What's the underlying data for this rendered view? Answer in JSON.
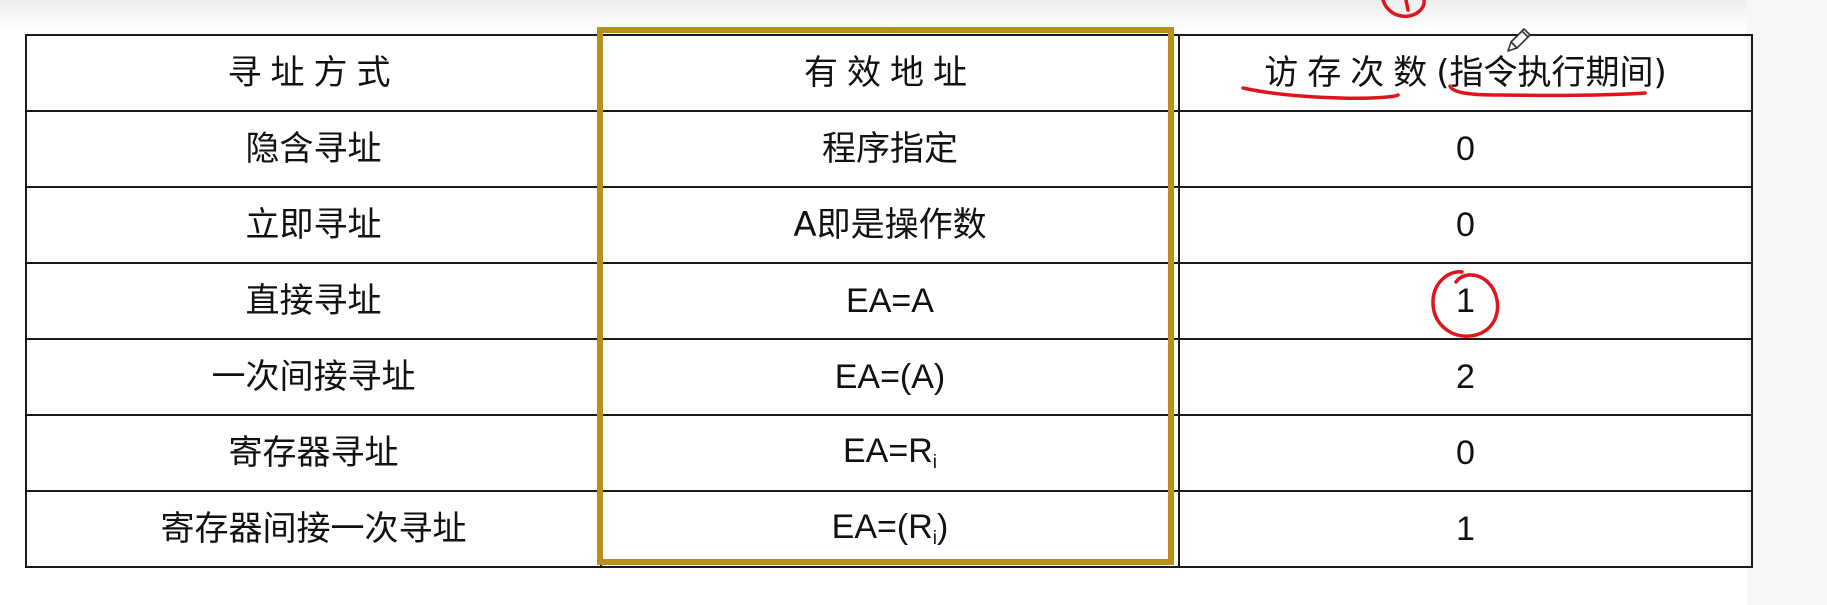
{
  "table": {
    "headers": {
      "mode": "寻址方式",
      "ea": "有效地址",
      "access_main": "访存次数",
      "access_note": "(指令执行期间)"
    },
    "rows": [
      {
        "mode": "隐含寻址",
        "ea": "程序指定",
        "count": "0"
      },
      {
        "mode": "立即寻址",
        "ea": "A即是操作数",
        "count": "0"
      },
      {
        "mode": "直接寻址",
        "ea": "EA=A",
        "count": "1"
      },
      {
        "mode": "一次间接寻址",
        "ea": "EA=(A)",
        "count": "2"
      },
      {
        "mode": "寄存器寻址",
        "ea_prefix": "EA=R",
        "ea_sub": "i",
        "ea_suffix": "",
        "count": "0"
      },
      {
        "mode": "寄存器间接一次寻址",
        "ea_prefix": "EA=(R",
        "ea_sub": "i",
        "ea_suffix": ")",
        "count": "1"
      }
    ]
  },
  "annotations": {
    "ink_color": "#e0141c",
    "frame_color": "#b8901a",
    "pen_cursor_icon": "pencil-cursor-icon"
  }
}
